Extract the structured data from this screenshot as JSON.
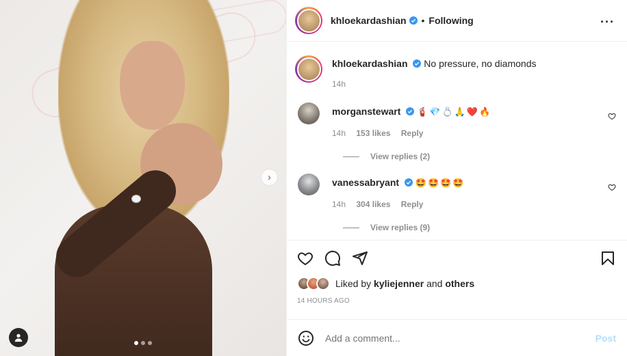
{
  "colors": {
    "verified": "#3897f0",
    "text": "#262626",
    "muted": "#8e8e8e",
    "post_disabled": "#b2dffc"
  },
  "photo": {
    "carousel_dots": 3,
    "active_dot": 0,
    "icons": {
      "next": "chevron-right-icon",
      "user_tag": "person-icon"
    }
  },
  "header": {
    "username": "khloekardashian",
    "separator": "•",
    "following_label": "Following",
    "more_icon": "more-horizontal-icon"
  },
  "caption": {
    "username": "khloekardashian",
    "text": "No pressure, no diamonds",
    "time": "14h"
  },
  "comments": [
    {
      "username": "morganstewart",
      "text": "🧯💎💍🙏❤️🔥",
      "time": "14h",
      "likes": "153 likes",
      "reply_label": "Reply",
      "view_replies": "View replies (2)"
    },
    {
      "username": "vanessabryant",
      "text": "🤩🤩🤩🤩",
      "time": "14h",
      "likes": "304 likes",
      "reply_label": "Reply",
      "view_replies": "View replies (9)"
    }
  ],
  "actions": {
    "icons": [
      "heart-icon",
      "comment-icon",
      "share-icon",
      "bookmark-icon"
    ],
    "liked_prefix": "Liked by",
    "liked_user": "kyliejenner",
    "liked_and": "and",
    "liked_others": "others",
    "timestamp": "14 HOURS AGO"
  },
  "add_comment": {
    "placeholder": "Add a comment...",
    "post_label": "Post",
    "emoji_icon": "emoji-smile-icon"
  }
}
